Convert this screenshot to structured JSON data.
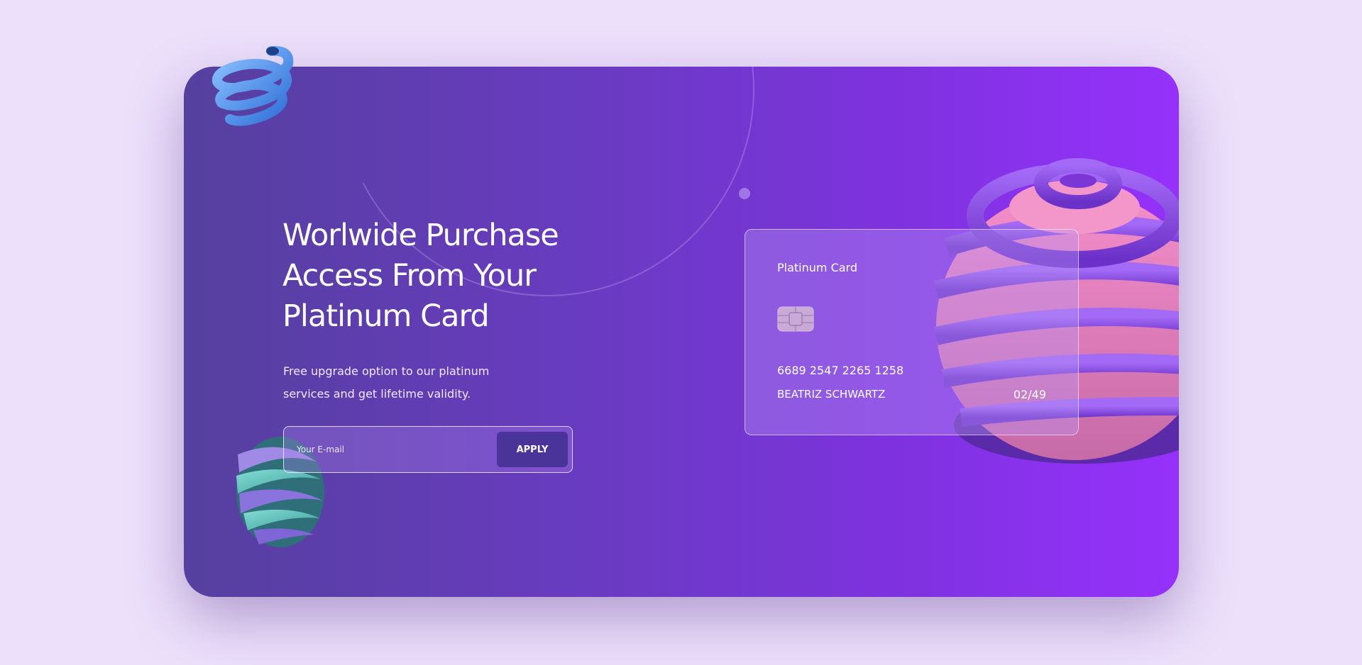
{
  "hero": {
    "title_lines": [
      "Worlwide Purchase",
      "Access From Your",
      "Platinum Card"
    ],
    "subtitle_lines": [
      "Free upgrade option to our platinum",
      "services and get lifetime validity."
    ]
  },
  "form": {
    "email_placeholder": "Your E-mail",
    "apply_label": "APPLY"
  },
  "card": {
    "name": "Platinum Card",
    "number": "6689 2547 2265 1258",
    "holder": "BEATRIZ SCHWARTZ",
    "expiry": "02/49"
  },
  "icons": {
    "chip": "card-chip-icon",
    "coil": "spiral-coil-decoration",
    "orb_left": "twisted-orb-decoration",
    "sphere_right": "ringed-sphere-decoration"
  },
  "colors": {
    "page_background": "#ece0fb",
    "gradient_start": "#55409e",
    "gradient_end": "#9631fb",
    "button": "#4b3499"
  }
}
